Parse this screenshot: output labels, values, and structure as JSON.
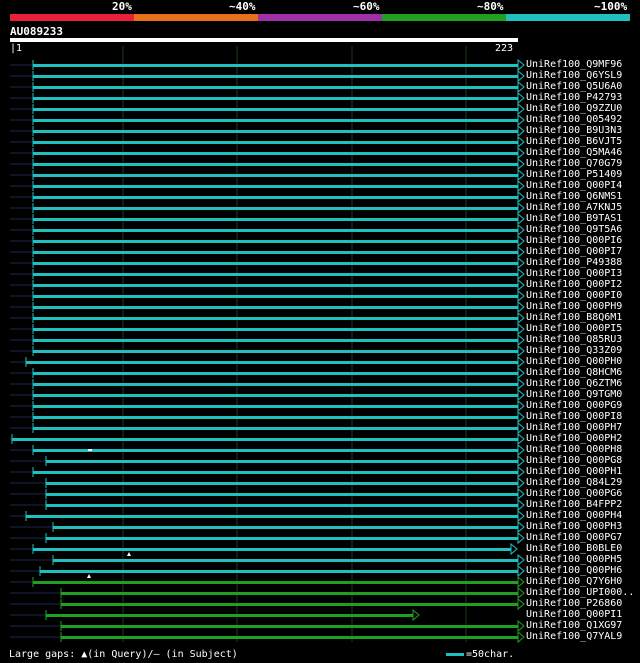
{
  "percent_scale": {
    "labels": [
      "20%",
      "~40%",
      "~60%",
      "~80%",
      "~100%"
    ],
    "colors": [
      "#e8203a",
      "#e8701a",
      "#a030a8",
      "#20a020",
      "#20c0c0"
    ]
  },
  "query": {
    "name": "AU089233",
    "start": "1",
    "end": "223"
  },
  "line_colors": {
    "cyan": "#20c0c0",
    "green": "#20a020"
  },
  "hits": [
    {
      "name": "UniRef100_Q9MF96",
      "start": 33,
      "end": 518,
      "color": "cyan",
      "tail": "arrow"
    },
    {
      "name": "UniRef100_Q6YSL9",
      "start": 33,
      "end": 518,
      "color": "cyan",
      "tail": "arrow"
    },
    {
      "name": "UniRef100_Q5U6A0",
      "start": 33,
      "end": 518,
      "color": "cyan",
      "tail": "arrow"
    },
    {
      "name": "UniRef100_P42793",
      "start": 33,
      "end": 518,
      "color": "cyan",
      "tail": "arrow"
    },
    {
      "name": "UniRef100_Q9ZZU0",
      "start": 33,
      "end": 518,
      "color": "cyan",
      "tail": "arrow"
    },
    {
      "name": "UniRef100_Q05492",
      "start": 33,
      "end": 518,
      "color": "cyan",
      "tail": "arrow"
    },
    {
      "name": "UniRef100_B9U3N3",
      "start": 33,
      "end": 518,
      "color": "cyan",
      "tail": "arrow"
    },
    {
      "name": "UniRef100_B6VJT5",
      "start": 33,
      "end": 518,
      "color": "cyan",
      "tail": "arrow"
    },
    {
      "name": "UniRef100_Q5MA46",
      "start": 33,
      "end": 518,
      "color": "cyan",
      "tail": "arrow"
    },
    {
      "name": "UniRef100_Q70G79",
      "start": 33,
      "end": 518,
      "color": "cyan",
      "tail": "arrow"
    },
    {
      "name": "UniRef100_P51409",
      "start": 33,
      "end": 518,
      "color": "cyan",
      "tail": "arrow"
    },
    {
      "name": "UniRef100_Q00PI4",
      "start": 33,
      "end": 518,
      "color": "cyan",
      "tail": "arrow"
    },
    {
      "name": "UniRef100_Q6NMS1",
      "start": 33,
      "end": 518,
      "color": "cyan",
      "tail": "arrow"
    },
    {
      "name": "UniRef100_A7KNJ5",
      "start": 33,
      "end": 518,
      "color": "cyan",
      "tail": "arrow"
    },
    {
      "name": "UniRef100_B9TAS1",
      "start": 33,
      "end": 518,
      "color": "cyan",
      "tail": "arrow"
    },
    {
      "name": "UniRef100_Q9T5A6",
      "start": 33,
      "end": 518,
      "color": "cyan",
      "tail": "arrow"
    },
    {
      "name": "UniRef100_Q00PI6",
      "start": 33,
      "end": 518,
      "color": "cyan",
      "tail": "arrow"
    },
    {
      "name": "UniRef100_Q00PI7",
      "start": 33,
      "end": 518,
      "color": "cyan",
      "tail": "arrow"
    },
    {
      "name": "UniRef100_P49388",
      "start": 33,
      "end": 518,
      "color": "cyan",
      "tail": "arrow"
    },
    {
      "name": "UniRef100_Q00PI3",
      "start": 33,
      "end": 518,
      "color": "cyan",
      "tail": "arrow"
    },
    {
      "name": "UniRef100_Q00PI2",
      "start": 33,
      "end": 518,
      "color": "cyan",
      "tail": "arrow"
    },
    {
      "name": "UniRef100_Q00PI0",
      "start": 33,
      "end": 518,
      "color": "cyan",
      "tail": "arrow"
    },
    {
      "name": "UniRef100_Q00PH9",
      "start": 33,
      "end": 518,
      "color": "cyan",
      "tail": "arrow"
    },
    {
      "name": "UniRef100_B8Q6M1",
      "start": 33,
      "end": 518,
      "color": "cyan",
      "tail": "arrow"
    },
    {
      "name": "UniRef100_Q00PI5",
      "start": 33,
      "end": 518,
      "color": "cyan",
      "tail": "arrow"
    },
    {
      "name": "UniRef100_Q85RU3",
      "start": 33,
      "end": 518,
      "color": "cyan",
      "tail": "arrow"
    },
    {
      "name": "UniRef100_Q33Z09",
      "start": 33,
      "end": 518,
      "color": "cyan",
      "tail": "arrow"
    },
    {
      "name": "UniRef100_Q00PH0",
      "start": 26,
      "end": 518,
      "color": "cyan",
      "tail": "arrow"
    },
    {
      "name": "UniRef100_Q8HCM6",
      "start": 33,
      "end": 518,
      "color": "cyan",
      "tail": "arrow"
    },
    {
      "name": "UniRef100_Q6ZTM6",
      "start": 33,
      "end": 518,
      "color": "cyan",
      "tail": "arrow"
    },
    {
      "name": "UniRef100_Q9TGM0",
      "start": 33,
      "end": 518,
      "color": "cyan",
      "tail": "arrow"
    },
    {
      "name": "UniRef100_Q00PG9",
      "start": 33,
      "end": 518,
      "color": "cyan",
      "tail": "arrow"
    },
    {
      "name": "UniRef100_Q00PI8",
      "start": 33,
      "end": 518,
      "color": "cyan",
      "tail": "arrow"
    },
    {
      "name": "UniRef100_Q00PH7",
      "start": 33,
      "end": 518,
      "color": "cyan",
      "tail": "arrow"
    },
    {
      "name": "UniRef100_Q00PH2",
      "start": 12,
      "end": 518,
      "color": "cyan",
      "tail": "arrow"
    },
    {
      "name": "UniRef100_Q00PH8",
      "start": 33,
      "end": 518,
      "color": "cyan",
      "tail": "arrow",
      "subject_gap_at": 90
    },
    {
      "name": "UniRef100_Q00PG8",
      "start": 46,
      "end": 518,
      "color": "cyan",
      "tail": "arrow"
    },
    {
      "name": "UniRef100_Q00PH1",
      "start": 33,
      "end": 518,
      "color": "cyan",
      "tail": "arrow"
    },
    {
      "name": "UniRef100_Q84L29",
      "start": 46,
      "end": 518,
      "color": "cyan",
      "tail": "arrow"
    },
    {
      "name": "UniRef100_Q00PG6",
      "start": 46,
      "end": 518,
      "color": "cyan",
      "tail": "arrow"
    },
    {
      "name": "UniRef100_B4FPP2",
      "start": 46,
      "end": 518,
      "color": "cyan",
      "tail": "arrow"
    },
    {
      "name": "UniRef100_Q00PH4",
      "start": 26,
      "end": 518,
      "color": "cyan",
      "tail": "arrow"
    },
    {
      "name": "UniRef100_Q00PH3",
      "start": 53,
      "end": 518,
      "color": "cyan",
      "tail": "arrow"
    },
    {
      "name": "UniRef100_Q00PG7",
      "start": 46,
      "end": 518,
      "color": "cyan",
      "tail": "arrow"
    },
    {
      "name": "UniRef100_B0BLE0",
      "start": 33,
      "end": 511,
      "color": "cyan",
      "tail": "arrow"
    },
    {
      "name": "UniRef100_Q00PH5",
      "start": 53,
      "end": 518,
      "color": "cyan",
      "tail": "arrow",
      "query_gap_at": 129
    },
    {
      "name": "UniRef100_Q00PH6",
      "start": 40,
      "end": 518,
      "color": "cyan",
      "tail": "arrow"
    },
    {
      "name": "UniRef100_Q7Y6H0",
      "start": 33,
      "end": 518,
      "color": "green",
      "tail": "arrow",
      "query_gap_at": 89
    },
    {
      "name": "UniRef100_UPI000..",
      "start": 61,
      "end": 518,
      "color": "green",
      "tail": "arrow"
    },
    {
      "name": "UniRef100_P26860",
      "start": 61,
      "end": 518,
      "color": "green",
      "tail": "arrow"
    },
    {
      "name": "UniRef100_Q00PI1",
      "start": 46,
      "end": 413,
      "color": "green",
      "tail": "arrow"
    },
    {
      "name": "UniRef100_Q1XG97",
      "start": 61,
      "end": 518,
      "color": "green",
      "tail": "arrow"
    },
    {
      "name": "UniRef100_Q7YAL9",
      "start": 61,
      "end": 518,
      "color": "green",
      "tail": "arrow"
    }
  ],
  "legend": {
    "gaps_text": "Large gaps: ▲(in Query)/– (in Subject)",
    "scale_text": "=50char."
  }
}
